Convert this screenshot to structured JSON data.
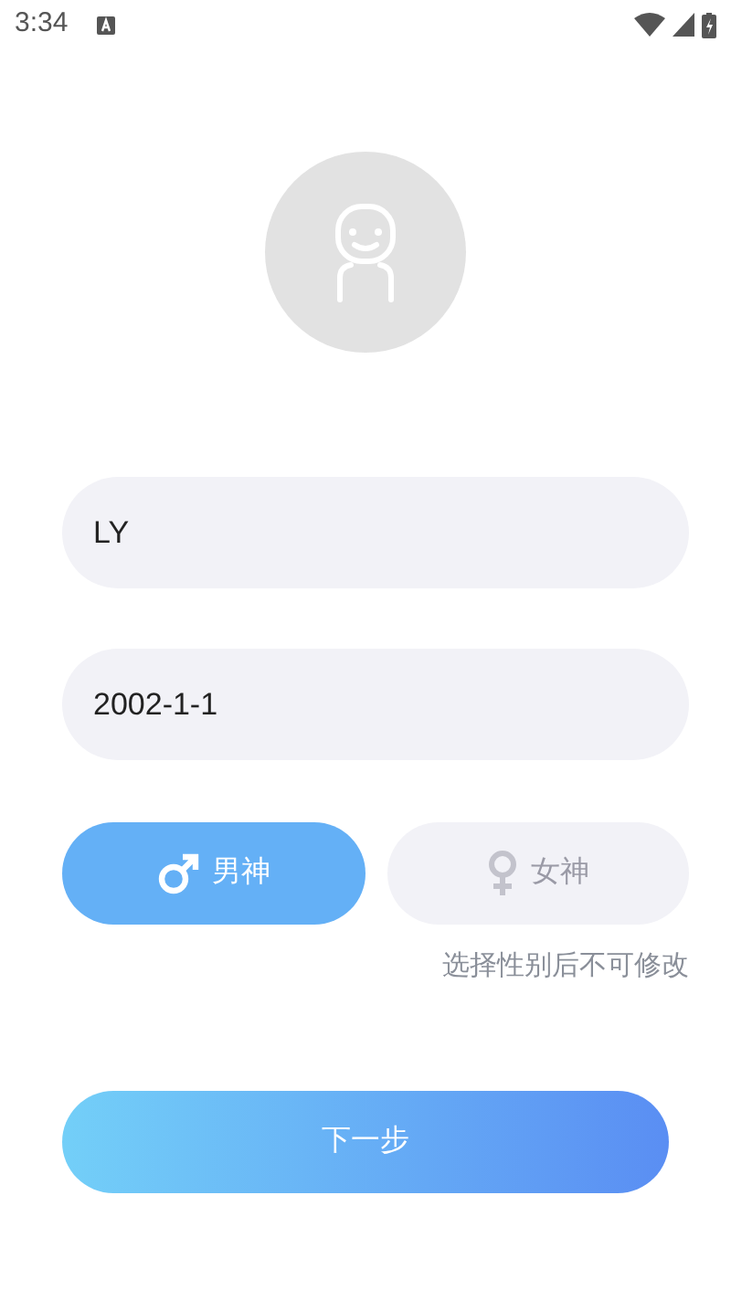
{
  "status_bar": {
    "time": "3:34"
  },
  "fields": [
    {
      "value": "LY"
    },
    {
      "value": "2002-1-1"
    }
  ],
  "genders": [
    {
      "kind": "male",
      "label": "男神",
      "selected": true
    },
    {
      "kind": "female",
      "label": "女神",
      "selected": false
    }
  ],
  "hint": "选择性别后不可修改",
  "next_button": "下一步"
}
